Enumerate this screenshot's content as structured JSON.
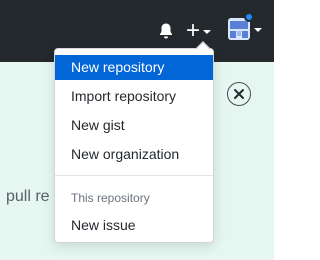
{
  "header": {
    "notifications_icon": "bell-icon",
    "create_icon": "plus-icon",
    "avatar_icon": "user-avatar"
  },
  "banner": {
    "background_text": "pull re",
    "close_icon": "close-icon"
  },
  "dropdown": {
    "items": [
      {
        "label": "New repository",
        "active": true
      },
      {
        "label": "Import repository"
      },
      {
        "label": "New gist"
      },
      {
        "label": "New organization"
      }
    ],
    "section_header": "This repository",
    "section_items": [
      {
        "label": "New issue"
      }
    ]
  },
  "colors": {
    "header_bg": "#24292e",
    "banner_bg": "#e6f7f1",
    "active_item_bg": "#0366d6",
    "notification_dot": "#2188ff"
  }
}
